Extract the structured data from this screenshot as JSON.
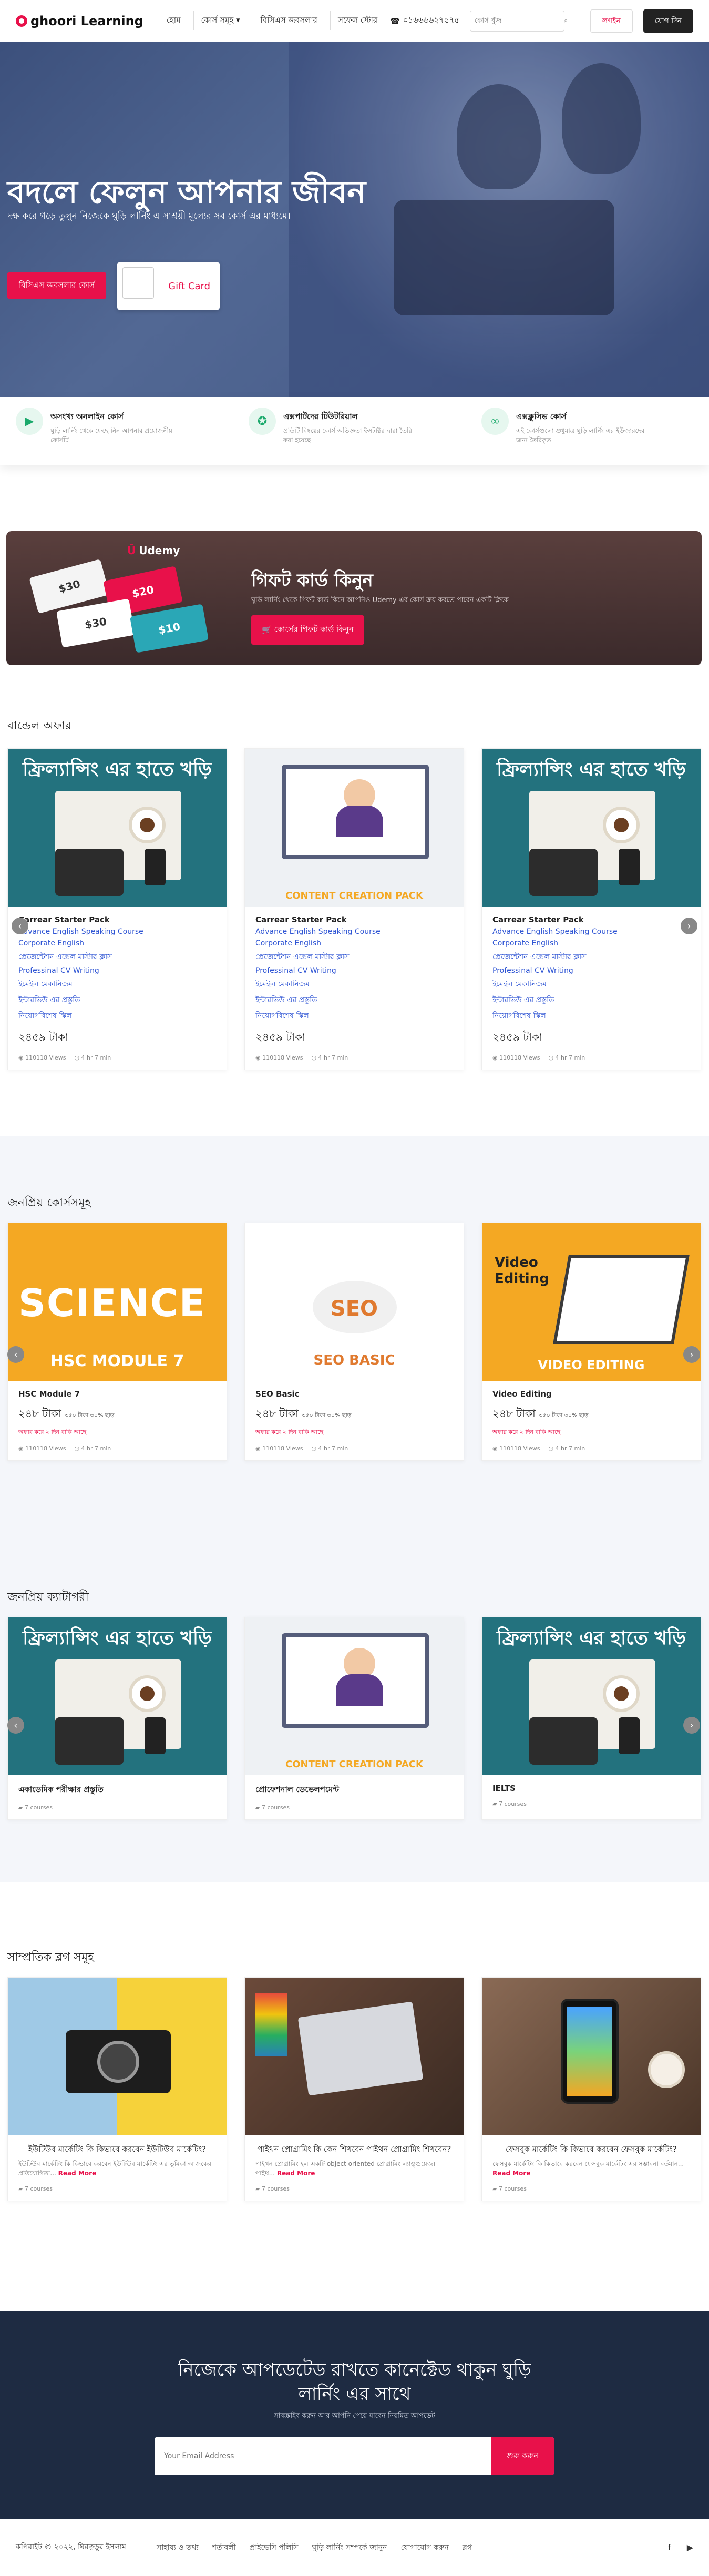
{
  "nav": {
    "logo": "ghoori Learning",
    "items": [
      "হোম",
      "কোর্স সমূহ",
      "বিসিএস জবসলার",
      "সফেল স্টোর"
    ],
    "phone": "০১৬৬৬৬২৭৫৭৫",
    "search_placeholder": "কোর্স খুঁজ",
    "login": "লগইন",
    "join": "যোগ দিন"
  },
  "hero": {
    "title": "বদলে ফেলুন আপনার জীবন",
    "subtitle": "দক্ষ করে গড়ে তুলুন নিজেকে ঘুড়ি লার্নিং এ সাশ্রয়ী মূল্যের সব কোর্স এর মাধ্যমে।",
    "button": "বিসিএস জবসলার কোর্স",
    "gift_card": "Gift Card"
  },
  "features": [
    {
      "title": "অসংখ্য অনলাইন কোর্স",
      "desc": "ঘুড়ি লার্নিং থেকে ফেছে নিন আপনার প্রয়োজনীয় কোর্সটি"
    },
    {
      "title": "এক্সপার্টদের টিউটরিয়াল",
      "desc": "প্রতিটি বিষয়ের কোর্স অভিজ্ঞতা ইন্সটাক্টর দ্বারা তৈরি করা হয়েছে"
    },
    {
      "title": "এক্সক্লুসিভ কোর্স",
      "desc": "এই কোর্সগুলো শুধুমাত্র ঘুড়ি লার্নিং এর ইউজারদের জন্য তৈরিকৃত"
    }
  ],
  "gift_banner": {
    "brand": "Udemy",
    "title": "গিফট কার্ড কিনুন",
    "subtitle": "ঘুড়ি লার্নিং থেকে গিফট কার্ড কিনে আপনিও Udemy এর কোর্স ক্রয় করতে পারেন একটি ক্লিকে",
    "button": "কোর্সের গিফট কার্ড কিনুন",
    "tickets": [
      "$30",
      "$20",
      "$30",
      "$10"
    ]
  },
  "bundle": {
    "title": "বান্ডেল অফার",
    "cards": [
      {
        "banner": "ফ্রিল্যান্সিং এর হাতে খড়ি",
        "name": "Carrear Starter Pack",
        "bullets": [
          "Advance English Speaking Course",
          "Corporate English",
          "প্রেজেন্টেশন এক্সেল মাস্টার ক্লাস",
          "Professinal CV Writing",
          "ইমেইল মেকানিজম",
          "ইন্টারভিউ এর প্রস্তুতি",
          "নিয়োগবিশেষ স্কিল"
        ],
        "price": "২৪৫৯ টাকা",
        "views": "110118 Views",
        "time": "4 hr 7 min"
      },
      {
        "banner": "CONTENT CREATION PACK",
        "name": "Carrear Starter Pack",
        "bullets": [
          "Advance English Speaking Course",
          "Corporate English",
          "প্রেজেন্টেশন এক্সেল মাস্টার ক্লাস",
          "Professinal CV Writing",
          "ইমেইল মেকানিজম",
          "ইন্টারভিউ এর প্রস্তুতি",
          "নিয়োগবিশেষ স্কিল"
        ],
        "price": "২৪৫৯ টাকা",
        "views": "110118 Views",
        "time": "4 hr 7 min"
      },
      {
        "banner": "ফ্রিল্যান্সিং এর হাতে খড়ি",
        "name": "Carrear Starter Pack",
        "bullets": [
          "Advance English Speaking Course",
          "Corporate English",
          "প্রেজেন্টেশন এক্সেল মাস্টার ক্লাস",
          "Professinal CV Writing",
          "ইমেইল মেকানিজম",
          "ইন্টারভিউ এর প্রস্তুতি",
          "নিয়োগবিশেষ স্কিল"
        ],
        "price": "২৪৫৯ টাকা",
        "views": "110118 Views",
        "time": "4 hr 7 min"
      }
    ]
  },
  "popular": {
    "title": "জনপ্রিয় কোর্সসমূহ",
    "cards": [
      {
        "art": "SCIENCE",
        "art_sub": "HSC MODULE 7",
        "name": "HSC Module 7",
        "price": "২৪৮ টাকা",
        "old_price": "৩৫০ টাকা ৩০% ছাড়",
        "note": "অফার করে ২ দিন বাকি আছে",
        "views": "110118 Views",
        "time": "4 hr 7 min"
      },
      {
        "art": "SEO",
        "art_sub": "SEO BASIC",
        "name": "SEO Basic",
        "price": "২৪৮ টাকা",
        "old_price": "৩৫০ টাকা ৩০% ছাড়",
        "note": "অফার করে ২ দিন বাকি আছে",
        "views": "110118 Views",
        "time": "4 hr 7 min"
      },
      {
        "art": "Video Editing",
        "art_sub": "VIDEO EDITING",
        "name": "Video Editing",
        "price": "২৪৮ টাকা",
        "old_price": "৩৫০ টাকা ৩০% ছাড়",
        "note": "অফার করে ২ দিন বাকি আছে",
        "views": "110118 Views",
        "time": "4 hr 7 min"
      }
    ]
  },
  "category": {
    "title": "জনপ্রিয় ক্যাটাগরী",
    "cards": [
      {
        "banner": "ফ্রিল্যান্সিং এর হাতে খড়ি",
        "name": "একাডেমিক পরীক্ষার প্রস্তুতি",
        "count": "7 courses"
      },
      {
        "banner": "CONTENT CREATION PACK",
        "name": "প্রোফেশনাল ডেভেলপমেন্ট",
        "count": "7 courses"
      },
      {
        "banner": "ফ্রিল্যান্সিং এর হাতে খড়ি",
        "name": "IELTS",
        "count": "7 courses"
      }
    ]
  },
  "blogs": {
    "title": "সাম্প্রতিক ব্লগ সমূহ",
    "cards": [
      {
        "title": "ইউটিউব মার্কেটিং কি কিভাবে করবেন ইউটিউব মার্কেটিং?",
        "desc": "ইউটিউব মার্কেটিং কি কিভাবে করবেন ইউটিউব মার্কেটিং এর ভূমিকা আজকের প্রতিযোগিতা...",
        "more": "Read More",
        "count": "7 courses"
      },
      {
        "title": "পাইথন প্রোগ্রামিং কি কেন শিখবেন পাইথন প্রোগ্রামিং শিখবেন?",
        "desc": "পাইথন প্রোগ্রামিং হল একটি object oriented প্রোগ্রামিং ল্যাঙ্গুয়েজ। পাইথ...",
        "more": "Read More",
        "count": "7 courses"
      },
      {
        "title": "ফেসবুক মার্কেটিং কি কিভাবে করবেন ফেসবুক মার্কেটিং?",
        "desc": "ফেসবুক মার্কেটিং কি কিভাবে করবেন ফেসবুক মার্কেটিং এর সম্ভাবনা বর্তমান...",
        "more": "Read More",
        "count": "7 courses"
      }
    ]
  },
  "newsletter": {
    "title": "নিজেকে আপডেটেড রাখতে কানেক্টেড থাকুন ঘুড়ি লার্নিং এর সাথে",
    "subtitle": "সাবস্ক্রাইব করুন আর আপনি পেয়ে যাবেন নিয়মিত আপডেট",
    "placeholder": "Your Email Address",
    "button": "শুরু করুন"
  },
  "footer": {
    "copyright": "কপিরাইট © ২০২২, ঘিরত্নড়ুর ইসলাম",
    "links": [
      "সাহায্য ও তথ্য",
      "শর্তাবলী",
      "প্রাইভেসি পলিসি",
      "ঘুড়ি লার্নিং সম্পর্কে জানুন",
      "যোগাযোগ করুন",
      "ব্লগ"
    ],
    "social": [
      "f",
      "▶"
    ]
  }
}
